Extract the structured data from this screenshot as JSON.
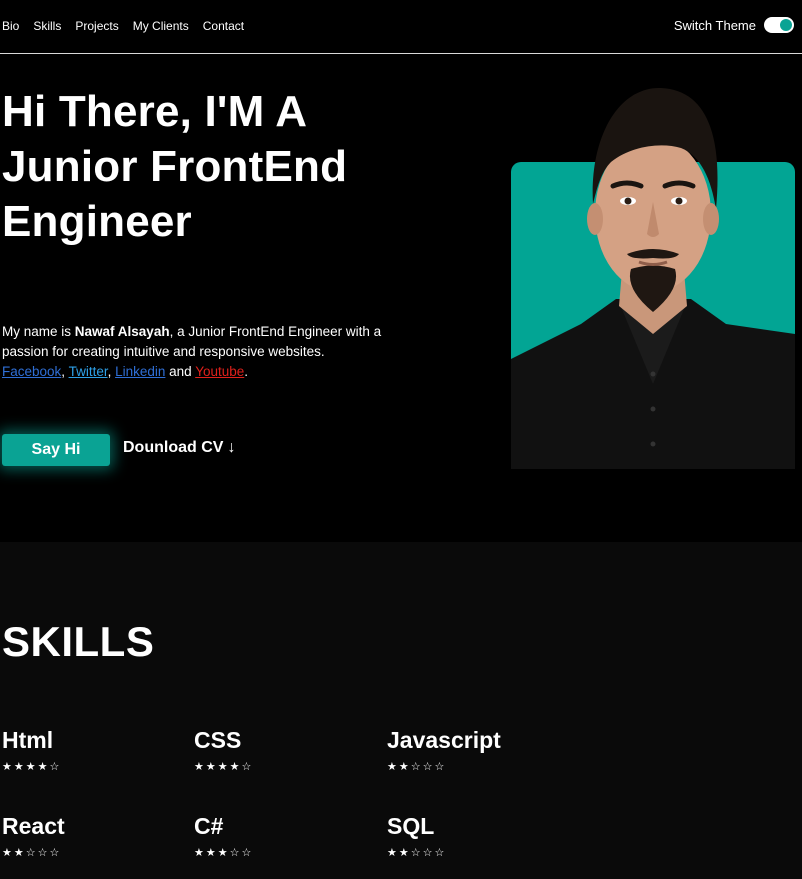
{
  "nav": {
    "links": [
      "Bio",
      "Skills",
      "Projects",
      "My Clients",
      "Contact"
    ],
    "switch_label": "Switch Theme"
  },
  "hero": {
    "title": "Hi There, I'M A Junior FrontEnd Engineer",
    "desc_prefix": "My name is ",
    "name": "Nawaf Alsayah",
    "desc_middle": ", a Junior FrontEnd Engineer with a passion for creating intuitive and responsive websites. ",
    "links": {
      "facebook": "Facebook",
      "twitter": "Twitter",
      "linkedin": "Linkedin",
      "youtube": "Youtube"
    },
    "and_text": "and",
    "say_hi": "Say Hi",
    "download_cv": "Dounload CV",
    "download_arrow": "↓"
  },
  "skills": {
    "title": "SKILLS",
    "items": [
      {
        "name": "Html",
        "rating": 4,
        "stars": "★★★★☆"
      },
      {
        "name": "CSS",
        "rating": 4,
        "stars": "★★★★☆"
      },
      {
        "name": "Javascript",
        "rating": 2,
        "stars": "★★☆☆☆"
      },
      {
        "name": "React",
        "rating": 2,
        "stars": "★★☆☆☆"
      },
      {
        "name": "C#",
        "rating": 3,
        "stars": "★★★☆☆"
      },
      {
        "name": "SQL",
        "rating": 2,
        "stars": "★★☆☆☆"
      }
    ]
  },
  "colors": {
    "accent": "#0aa394",
    "background": "#000000",
    "section_bg": "#0a0a0a"
  }
}
